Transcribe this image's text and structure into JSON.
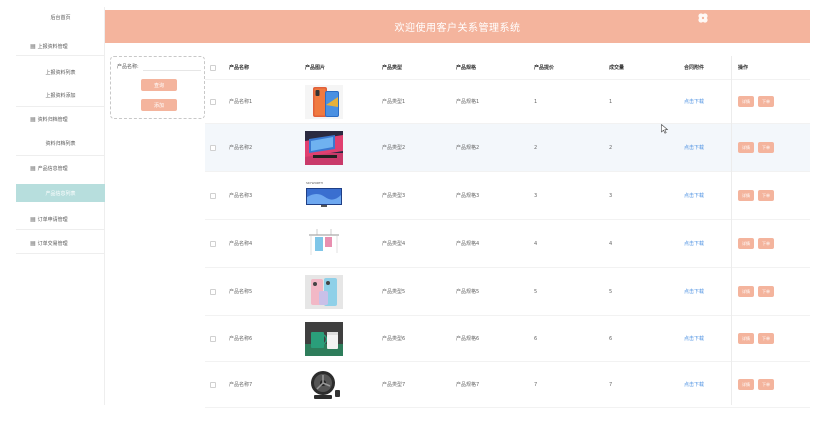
{
  "sidebar": {
    "items": [
      {
        "label": "后台首页",
        "type": "plain",
        "icon": ""
      },
      {
        "label": "上报资料管理",
        "type": "group",
        "icon": "grid-icon"
      },
      {
        "label": "上报资料列表",
        "type": "plain",
        "icon": ""
      },
      {
        "label": "上报资料添加",
        "type": "plain",
        "icon": ""
      },
      {
        "label": "资料归档管理",
        "type": "group",
        "icon": "grid-icon"
      },
      {
        "label": "资料归档列表",
        "type": "plain",
        "icon": ""
      },
      {
        "label": "产品信息管理",
        "type": "group",
        "icon": "grid-icon"
      },
      {
        "label": "产品信息列表",
        "type": "active",
        "icon": ""
      },
      {
        "label": "订单申请管理",
        "type": "group",
        "icon": "grid-icon"
      },
      {
        "label": "订单交易管理",
        "type": "group",
        "icon": "grid-icon"
      }
    ]
  },
  "header": {
    "title": "欢迎使用客户关系管理系统",
    "logo_icon": "flower-logo-icon"
  },
  "search": {
    "label": "产品名称:",
    "placeholder": "",
    "search_label": "查询",
    "add_label": "添加"
  },
  "table": {
    "columns": [
      "产品名称",
      "产品图片",
      "产品类型",
      "产品规格",
      "产品提价",
      "成交量",
      "合同附件",
      "操作"
    ],
    "rows": [
      {
        "name": "产品名称1",
        "image": "phone-image",
        "type": "产品类型1",
        "spec": "产品规格1",
        "price": "1",
        "volume": "1",
        "attachment": "点击下载",
        "op1": "详情",
        "op2": "下单"
      },
      {
        "name": "产品名称2",
        "image": "laptop-image",
        "type": "产品类型2",
        "spec": "产品规格2",
        "price": "2",
        "volume": "2",
        "attachment": "点击下载",
        "op1": "详情",
        "op2": "下单"
      },
      {
        "name": "产品名称3",
        "image": "tv-image",
        "type": "产品类型3",
        "spec": "产品规格3",
        "price": "3",
        "volume": "3",
        "attachment": "点击下载",
        "op1": "详情",
        "op2": "下单"
      },
      {
        "name": "产品名称4",
        "image": "rack-image",
        "type": "产品类型4",
        "spec": "产品规格4",
        "price": "4",
        "volume": "4",
        "attachment": "点击下载",
        "op1": "详情",
        "op2": "下单"
      },
      {
        "name": "产品名称5",
        "image": "phones-image",
        "type": "产品类型5",
        "spec": "产品规格5",
        "price": "5",
        "volume": "5",
        "attachment": "点击下载",
        "op1": "详情",
        "op2": "下单"
      },
      {
        "name": "产品名称6",
        "image": "mug-image",
        "type": "产品类型6",
        "spec": "产品规格6",
        "price": "6",
        "volume": "6",
        "attachment": "点击下载",
        "op1": "详情",
        "op2": "下单"
      },
      {
        "name": "产品名称7",
        "image": "fan-image",
        "type": "产品类型7",
        "spec": "产品规格7",
        "price": "7",
        "volume": "7",
        "attachment": "点击下载",
        "op1": "详情",
        "op2": "下单"
      }
    ]
  },
  "colors": {
    "accent": "#f4b49d",
    "active_menu": "#b7dedd",
    "link": "#4a90e2",
    "row_alt": "#f3f7fb"
  }
}
